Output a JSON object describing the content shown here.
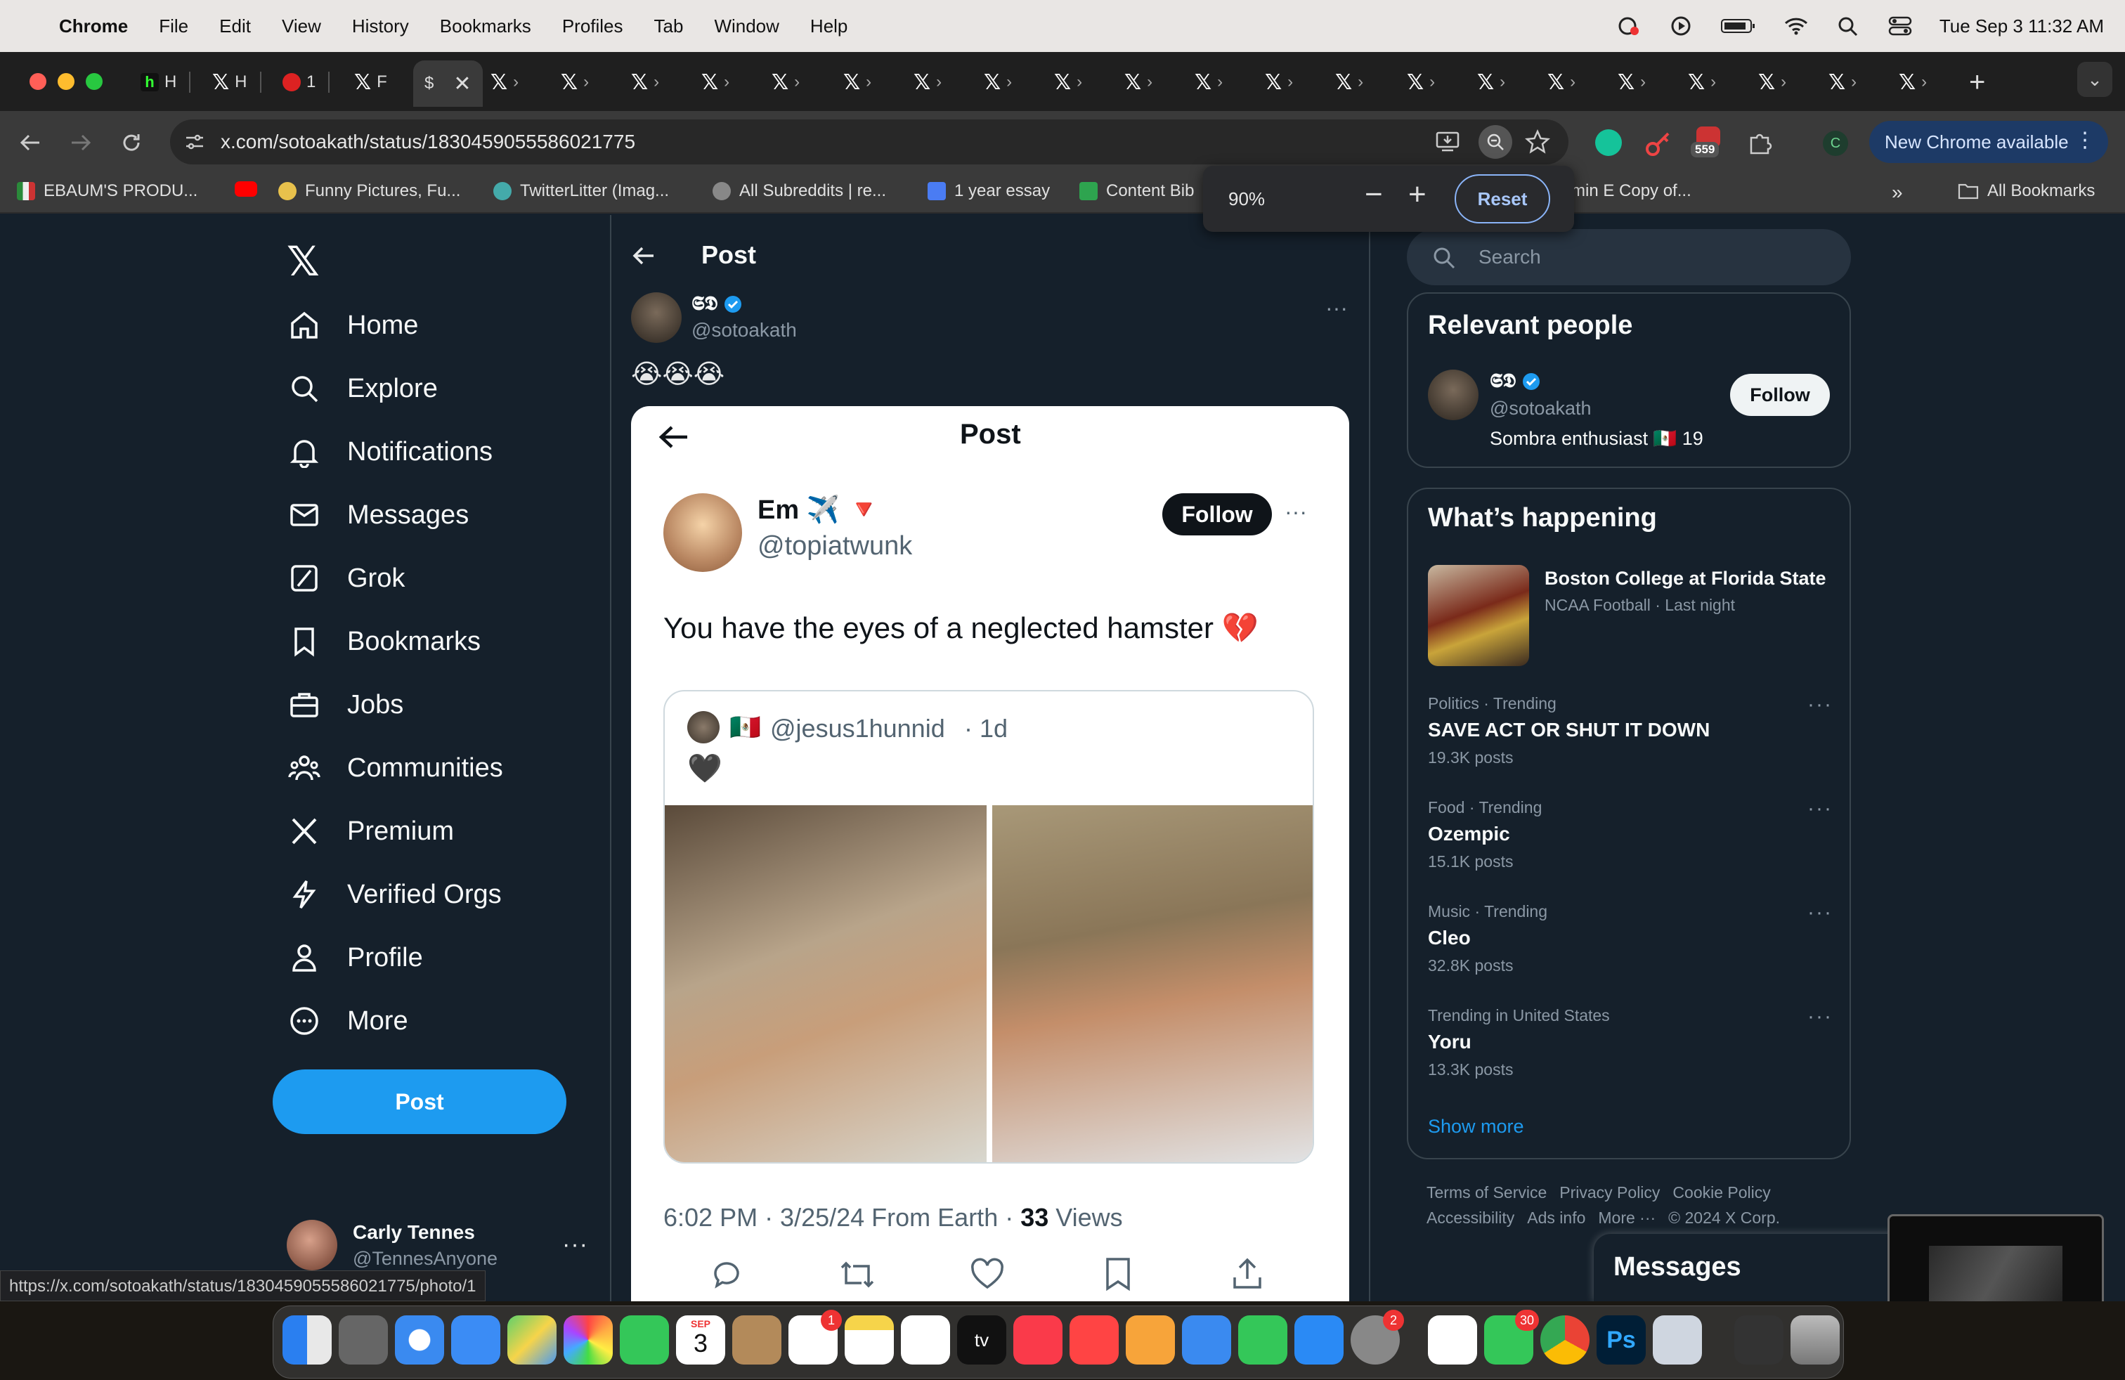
{
  "menubar": {
    "app": "Chrome",
    "items": [
      "File",
      "Edit",
      "View",
      "History",
      "Bookmarks",
      "Profiles",
      "Tab",
      "Window",
      "Help"
    ],
    "clock": "Tue Sep 3  11:32 AM"
  },
  "browser": {
    "tabs": [
      {
        "label": "H"
      },
      {
        "label": "H"
      },
      {
        "label": "1"
      },
      {
        "label": "F"
      },
      {
        "label": "$"
      }
    ],
    "url": "x.com/sotoakath/status/1830459055586021775",
    "extension_badge": "559",
    "profile_initial": "C",
    "new_chrome": "New Chrome available",
    "zoom": {
      "value": "90%",
      "minus": "−",
      "plus": "+",
      "reset": "Reset"
    },
    "bookmarks": [
      "EBAUM'S PRODU...",
      "Funny Pictures, Fu...",
      "TwitterLitter (Imag...",
      "All Subreddits | re...",
      "1 year essay",
      "Content Bib",
      "min E Copy of...",
      "All Bookmarks"
    ],
    "status_url": "https://x.com/sotoakath/status/1830459055586021775/photo/1"
  },
  "nav": {
    "items": [
      "Home",
      "Explore",
      "Notifications",
      "Messages",
      "Grok",
      "Bookmarks",
      "Jobs",
      "Communities",
      "Premium",
      "Verified Orgs",
      "Profile",
      "More"
    ],
    "post_button": "Post",
    "account_name": "Carly Tennes",
    "account_handle": "@TennesAnyone"
  },
  "main": {
    "header_title": "Post",
    "author_name": "𝕾𝕯",
    "author_handle": "@sotoakath",
    "post_text": "😭😭😭",
    "embedded": {
      "header_title": "Post",
      "name": "Em ✈️ 🔻",
      "handle": "@topiatwunk",
      "follow": "Follow",
      "text": "You have the eyes of a neglected hamster 💔",
      "quote_flag": "🇲🇽",
      "quote_handle": "@jesus1hunnid",
      "quote_time": "· 1d",
      "quote_text": "🖤",
      "timestamp": "6:02 PM · 3/25/24 From Earth · ",
      "views_count": "33",
      "views_label": " Views"
    }
  },
  "right": {
    "search_placeholder": "Search",
    "relevant_title": "Relevant people",
    "relevant_name": "𝕾𝕯",
    "relevant_handle": "@sotoakath",
    "relevant_bio": "Sombra enthusiast 🇲🇽 19",
    "follow": "Follow",
    "happening_title": "What’s happening",
    "feature": {
      "title": "Boston College at Florida State",
      "meta": "NCAA Football · Last night"
    },
    "trends": [
      {
        "meta": "Politics · Trending",
        "title": "SAVE ACT OR SHUT IT DOWN",
        "count": "19.3K posts"
      },
      {
        "meta": "Food · Trending",
        "title": "Ozempic",
        "count": "15.1K posts"
      },
      {
        "meta": "Music · Trending",
        "title": "Cleo",
        "count": "32.8K posts"
      },
      {
        "meta": "Trending in United States",
        "title": "Yoru",
        "count": "13.3K posts"
      }
    ],
    "show_more": "Show more",
    "footer": [
      "Terms of Service",
      "Privacy Policy",
      "Cookie Policy",
      "Accessibility",
      "Ads info",
      "More ···",
      "© 2024 X Corp."
    ],
    "messages": "Messages"
  },
  "dock": {
    "calendar_month": "SEP",
    "calendar_day": "3",
    "badges": {
      "reminders": "1",
      "settings": "2",
      "messages": "30"
    }
  }
}
